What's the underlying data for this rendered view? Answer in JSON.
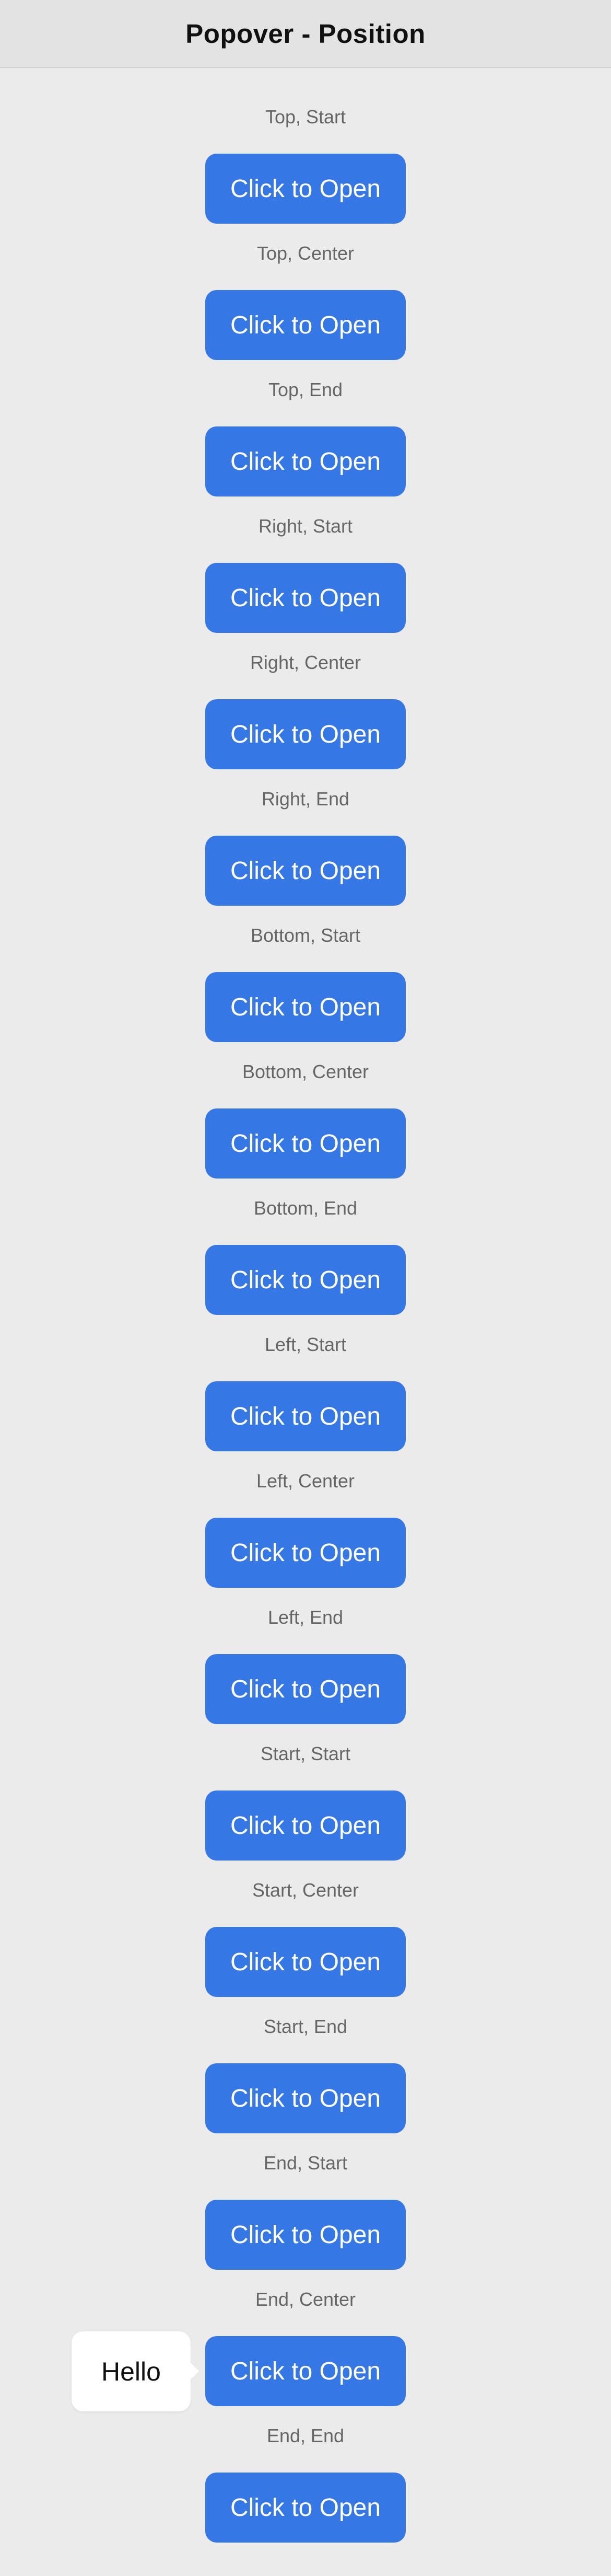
{
  "header": {
    "title": "Popover - Position"
  },
  "items": [
    {
      "label": "Top, Start",
      "button_label": "Click to Open"
    },
    {
      "label": "Top, Center",
      "button_label": "Click to Open"
    },
    {
      "label": "Top, End",
      "button_label": "Click to Open"
    },
    {
      "label": "Right, Start",
      "button_label": "Click to Open"
    },
    {
      "label": "Right, Center",
      "button_label": "Click to Open"
    },
    {
      "label": "Right, End",
      "button_label": "Click to Open"
    },
    {
      "label": "Bottom, Start",
      "button_label": "Click to Open"
    },
    {
      "label": "Bottom, Center",
      "button_label": "Click to Open"
    },
    {
      "label": "Bottom, End",
      "button_label": "Click to Open"
    },
    {
      "label": "Left, Start",
      "button_label": "Click to Open"
    },
    {
      "label": "Left, Center",
      "button_label": "Click to Open"
    },
    {
      "label": "Left, End",
      "button_label": "Click to Open"
    },
    {
      "label": "Start, Start",
      "button_label": "Click to Open"
    },
    {
      "label": "Start, Center",
      "button_label": "Click to Open"
    },
    {
      "label": "Start, End",
      "button_label": "Click to Open"
    },
    {
      "label": "End, Start",
      "button_label": "Click to Open"
    },
    {
      "label": "End, Center",
      "button_label": "Click to Open"
    },
    {
      "label": "End, End",
      "button_label": "Click to Open"
    }
  ],
  "popover": {
    "text": "Hello"
  },
  "colors": {
    "accent": "#3578e5",
    "background": "#ebebeb",
    "header_background": "#e3e3e3",
    "label_text": "#666666"
  }
}
